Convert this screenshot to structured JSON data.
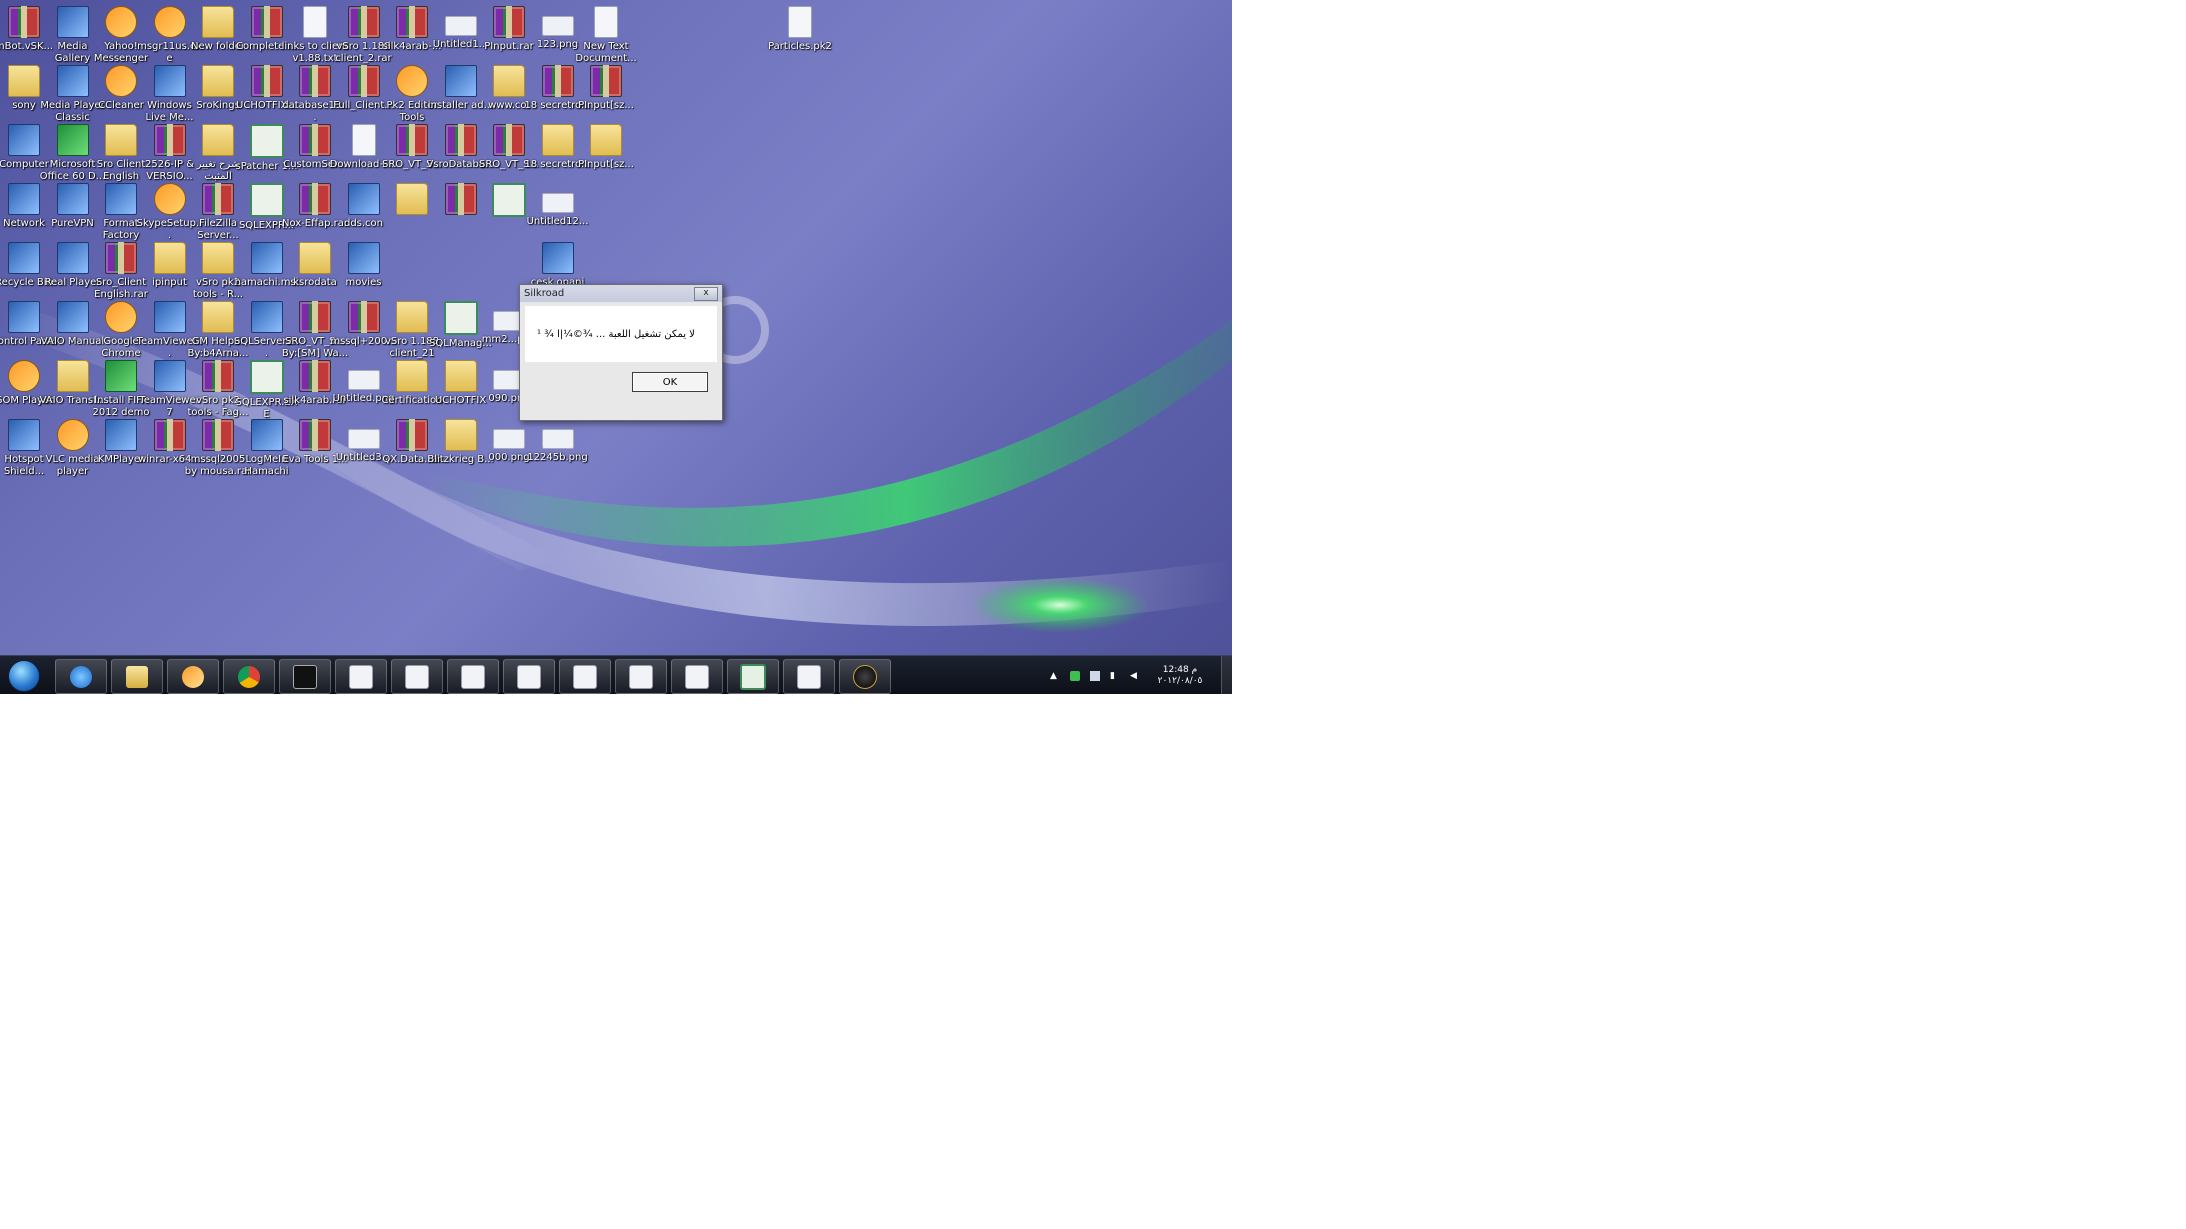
{
  "desktop": {
    "icons": [
      {
        "label": "mBot.vSK...",
        "type": "rar",
        "col": 0,
        "row": 0
      },
      {
        "label": "Media Gallery",
        "type": "sys",
        "col": 1,
        "row": 0
      },
      {
        "label": "Yahoo! Messenger",
        "type": "app",
        "col": 2,
        "row": 0
      },
      {
        "label": "msgr11us.exe",
        "type": "app",
        "col": 3,
        "row": 0
      },
      {
        "label": "New folder",
        "type": "folder",
        "col": 4,
        "row": 0
      },
      {
        "label": "Complete ...",
        "type": "rar",
        "col": 5,
        "row": 0
      },
      {
        "label": "links to client v1.88.txt",
        "type": "file",
        "col": 6,
        "row": 0
      },
      {
        "label": "vSro 1.188 client_2.rar",
        "type": "rar",
        "col": 7,
        "row": 0
      },
      {
        "label": "silk4arab-...",
        "type": "rar",
        "col": 8,
        "row": 0
      },
      {
        "label": "Untitled1...",
        "type": "png",
        "col": 9,
        "row": 0
      },
      {
        "label": "PInput.rar",
        "type": "rar",
        "col": 10,
        "row": 0
      },
      {
        "label": "123.png",
        "type": "png",
        "col": 11,
        "row": 0
      },
      {
        "label": "New Text Document...",
        "type": "file",
        "col": 12,
        "row": 0
      },
      {
        "label": "Particles.pk2",
        "type": "file",
        "col": 16,
        "row": 0
      },
      {
        "label": "sony",
        "type": "folder",
        "col": 0,
        "row": 1
      },
      {
        "label": "Media Player Classic",
        "type": "sys",
        "col": 1,
        "row": 1
      },
      {
        "label": "CCleaner",
        "type": "app",
        "col": 2,
        "row": 1
      },
      {
        "label": "Windows Live Me...",
        "type": "sys",
        "col": 3,
        "row": 1
      },
      {
        "label": "SroKings",
        "type": "folder",
        "col": 4,
        "row": 1
      },
      {
        "label": "UCHOTFIX...",
        "type": "rar",
        "col": 5,
        "row": 1
      },
      {
        "label": "database13...",
        "type": "rar",
        "col": 6,
        "row": 1
      },
      {
        "label": "Full_Client...",
        "type": "rar",
        "col": 7,
        "row": 1
      },
      {
        "label": "Pk2 Editor Tools",
        "type": "app",
        "col": 8,
        "row": 1
      },
      {
        "label": "installer ad...",
        "type": "sys",
        "col": 9,
        "row": 1
      },
      {
        "label": "www.co:",
        "type": "folder",
        "col": 10,
        "row": 1
      },
      {
        "label": "18 secretro...",
        "type": "rar",
        "col": 11,
        "row": 1
      },
      {
        "label": "PInput[sz...",
        "type": "rar",
        "col": 12,
        "row": 1
      },
      {
        "label": "Computer",
        "type": "sys",
        "col": 0,
        "row": 2
      },
      {
        "label": "Microsoft Office 60 D...",
        "type": "green",
        "col": 1,
        "row": 2
      },
      {
        "label": "Sro Client English",
        "type": "folder",
        "col": 2,
        "row": 2
      },
      {
        "label": "2526-IP & VERSIO...",
        "type": "rar",
        "col": 3,
        "row": 2
      },
      {
        "label": "شرح تغيير المثبت",
        "type": "folder",
        "col": 4,
        "row": 2
      },
      {
        "label": "sPatcher 1...",
        "type": "window",
        "col": 5,
        "row": 2
      },
      {
        "label": "CustomSer...",
        "type": "rar",
        "col": 6,
        "row": 2
      },
      {
        "label": "Download+...",
        "type": "file",
        "col": 7,
        "row": 2
      },
      {
        "label": "SRO_VT_S...",
        "type": "rar",
        "col": 8,
        "row": 2
      },
      {
        "label": "VsroDataba...",
        "type": "rar",
        "col": 9,
        "row": 2
      },
      {
        "label": "SRO_VT_S...",
        "type": "rar",
        "col": 10,
        "row": 2
      },
      {
        "label": "18 secretro...",
        "type": "folder",
        "col": 11,
        "row": 2
      },
      {
        "label": "PInput[sz...",
        "type": "folder",
        "col": 12,
        "row": 2
      },
      {
        "label": "Network",
        "type": "sys",
        "col": 0,
        "row": 3
      },
      {
        "label": "PureVPN",
        "type": "sys",
        "col": 1,
        "row": 3
      },
      {
        "label": "Format Factory",
        "type": "sys",
        "col": 2,
        "row": 3
      },
      {
        "label": "SkypeSetup...",
        "type": "app",
        "col": 3,
        "row": 3
      },
      {
        "label": "FileZilla Server...",
        "type": "rar",
        "col": 4,
        "row": 3
      },
      {
        "label": "SQLEXPR...",
        "type": "window",
        "col": 5,
        "row": 3
      },
      {
        "label": "Nox-Effap.rar",
        "type": "rar",
        "col": 6,
        "row": 3
      },
      {
        "label": "dds.con",
        "type": "sys",
        "col": 7,
        "row": 3
      },
      {
        "label": "",
        "type": "folder",
        "col": 8,
        "row": 3
      },
      {
        "label": "",
        "type": "rar",
        "col": 9,
        "row": 3
      },
      {
        "label": "",
        "type": "window",
        "col": 10,
        "row": 3
      },
      {
        "label": "Untitled12...",
        "type": "png",
        "col": 11,
        "row": 3
      },
      {
        "label": "Recycle Bin",
        "type": "sys",
        "col": 0,
        "row": 4
      },
      {
        "label": "Real Player",
        "type": "sys",
        "col": 1,
        "row": 4
      },
      {
        "label": "Sro_Client English.rar",
        "type": "rar",
        "col": 2,
        "row": 4
      },
      {
        "label": "ipinput",
        "type": "folder",
        "col": 3,
        "row": 4
      },
      {
        "label": "vSro pk2 tools - R...",
        "type": "folder",
        "col": 4,
        "row": 4
      },
      {
        "label": "hamachi.msi",
        "type": "sys",
        "col": 5,
        "row": 4
      },
      {
        "label": "ksrodata",
        "type": "folder",
        "col": 6,
        "row": 4
      },
      {
        "label": "movies",
        "type": "sys",
        "col": 7,
        "row": 4
      },
      {
        "label": "cesk.opani",
        "type": "sys",
        "col": 11,
        "row": 4
      },
      {
        "label": "Control Panel",
        "type": "sys",
        "col": 0,
        "row": 5
      },
      {
        "label": "VAIO Manual",
        "type": "sys",
        "col": 1,
        "row": 5
      },
      {
        "label": "Google Chrome",
        "type": "app",
        "col": 2,
        "row": 5
      },
      {
        "label": "TeamViewer...",
        "type": "sys",
        "col": 3,
        "row": 5
      },
      {
        "label": "GM Helper By:b4Arna...",
        "type": "folder",
        "col": 4,
        "row": 5
      },
      {
        "label": "SQLServer2...",
        "type": "sys",
        "col": 5,
        "row": 5
      },
      {
        "label": "SRO_VT_S... By:[SM] Wa...",
        "type": "rar",
        "col": 6,
        "row": 5
      },
      {
        "label": "mssql+200...",
        "type": "rar",
        "col": 7,
        "row": 5
      },
      {
        "label": "vSro 1.188 client_21",
        "type": "folder",
        "col": 8,
        "row": 5
      },
      {
        "label": "SQLManag...",
        "type": "window",
        "col": 9,
        "row": 5
      },
      {
        "label": "mm2...png",
        "type": "png",
        "col": 10,
        "row": 5
      },
      {
        "label": "cesk.opani",
        "type": "sys",
        "col": 11,
        "row": 5
      },
      {
        "label": "GOM Player",
        "type": "app",
        "col": 0,
        "row": 6
      },
      {
        "label": "VAIO Transf...",
        "type": "folder",
        "col": 1,
        "row": 6
      },
      {
        "label": "Install FIFA 2012 demo",
        "type": "green",
        "col": 2,
        "row": 6
      },
      {
        "label": "TeamViewer 7",
        "type": "sys",
        "col": 3,
        "row": 6
      },
      {
        "label": "vSro pk2 tools - Fag...",
        "type": "rar",
        "col": 4,
        "row": 6
      },
      {
        "label": "SQLEXPR.EXE",
        "type": "window",
        "col": 5,
        "row": 6
      },
      {
        "label": "silk4arab.rar",
        "type": "rar",
        "col": 6,
        "row": 6
      },
      {
        "label": "Untitled.png",
        "type": "png",
        "col": 7,
        "row": 6
      },
      {
        "label": "Certification",
        "type": "folder",
        "col": 8,
        "row": 6
      },
      {
        "label": "UCHOTFIX",
        "type": "folder",
        "col": 9,
        "row": 6
      },
      {
        "label": "090.png",
        "type": "png",
        "col": 10,
        "row": 6
      },
      {
        "label": "S4A Loader.rar",
        "type": "rar",
        "col": 11,
        "row": 6
      },
      {
        "label": "Hotspot Shield...",
        "type": "sys",
        "col": 0,
        "row": 7
      },
      {
        "label": "VLC media player",
        "type": "app",
        "col": 1,
        "row": 7
      },
      {
        "label": "KMPlayer",
        "type": "sys",
        "col": 2,
        "row": 7
      },
      {
        "label": "winrar-x64...",
        "type": "rar",
        "col": 3,
        "row": 7
      },
      {
        "label": "mssql2005 by mousa.rar",
        "type": "rar",
        "col": 4,
        "row": 7
      },
      {
        "label": "LogMeIn Hamachi",
        "type": "sys",
        "col": 5,
        "row": 7
      },
      {
        "label": "Eva Tools 1...",
        "type": "rar",
        "col": 6,
        "row": 7
      },
      {
        "label": "Untitled3...",
        "type": "png",
        "col": 7,
        "row": 7
      },
      {
        "label": "QX.Data.rar",
        "type": "rar",
        "col": 8,
        "row": 7
      },
      {
        "label": "Blitzkrieg B...",
        "type": "folder",
        "col": 9,
        "row": 7
      },
      {
        "label": "000.png",
        "type": "png",
        "col": 10,
        "row": 7
      },
      {
        "label": "12245b.png",
        "type": "png",
        "col": 11,
        "row": 7
      }
    ]
  },
  "dialog": {
    "title": "Silkroad",
    "close_label": "x",
    "message": "ﻻ ﻳﻤﻜﻦ ﺗﺸﻐﻴﻞ ﺍﻟﻠﻌﺒﺔ ... ¾©¼|ﺍ ¾ ¹",
    "ok_label": "OK"
  },
  "taskbar": {
    "buttons": [
      {
        "name": "taskbar-internet-explorer",
        "icon": "ie"
      },
      {
        "name": "taskbar-explorer",
        "icon": "exp"
      },
      {
        "name": "taskbar-media-player",
        "icon": "wmp"
      },
      {
        "name": "taskbar-chrome",
        "icon": "chrome"
      },
      {
        "name": "taskbar-cmd",
        "icon": "cmd"
      },
      {
        "name": "taskbar-window-1",
        "icon": "doc"
      },
      {
        "name": "taskbar-window-2",
        "icon": "doc"
      },
      {
        "name": "taskbar-window-3",
        "icon": "doc"
      },
      {
        "name": "taskbar-window-4",
        "icon": "doc"
      },
      {
        "name": "taskbar-window-5",
        "icon": "doc"
      },
      {
        "name": "taskbar-window-6",
        "icon": "doc"
      },
      {
        "name": "taskbar-window-7",
        "icon": "doc"
      },
      {
        "name": "taskbar-sql",
        "icon": "sql"
      },
      {
        "name": "taskbar-window-8",
        "icon": "doc"
      },
      {
        "name": "taskbar-compass",
        "icon": "compass"
      }
    ],
    "clock_time": "12:48 م",
    "clock_date": "٢٠١٢/٠٨/٠٥"
  }
}
